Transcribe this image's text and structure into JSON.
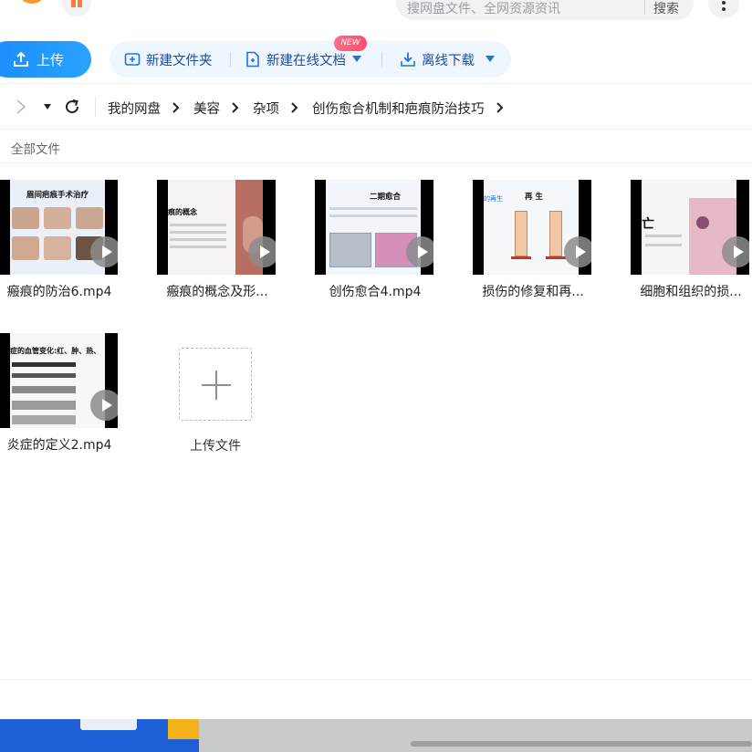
{
  "search": {
    "placeholder": "搜网盘文件、全网资源资讯",
    "button": "搜索"
  },
  "toolbar": {
    "upload_label": "上传",
    "new_folder_label": "新建文件夹",
    "new_online_doc_label": "新建在线文档",
    "new_badge": "NEW",
    "offline_download_label": "离线下载"
  },
  "breadcrumb": [
    "我的网盘",
    "美容",
    "杂项",
    "创伤愈合机制和疤痕防治技巧"
  ],
  "all_files_label": "全部文件",
  "files": [
    {
      "name": "瘢痕的防治6.mp4",
      "thumb_title": "眉间疤痕手术治疗"
    },
    {
      "name": "瘢痕的概念及形...",
      "thumb_title": "痕的概念"
    },
    {
      "name": "创伤愈合4.mp4",
      "thumb_title": "二期愈合"
    },
    {
      "name": "损伤的修复和再...",
      "thumb_title": "再 生",
      "thumb_sub": "的再生"
    },
    {
      "name": "细胞和组织的损...",
      "thumb_title": "亡"
    },
    {
      "name": "炎症的定义2.mp4",
      "thumb_title": "症的血管变化:红、肿、热、"
    }
  ],
  "upload_tile_label": "上传文件",
  "colors": {
    "accent": "#1a8cff",
    "link_text": "#1f4b99",
    "badge": "#ff4d6d"
  }
}
